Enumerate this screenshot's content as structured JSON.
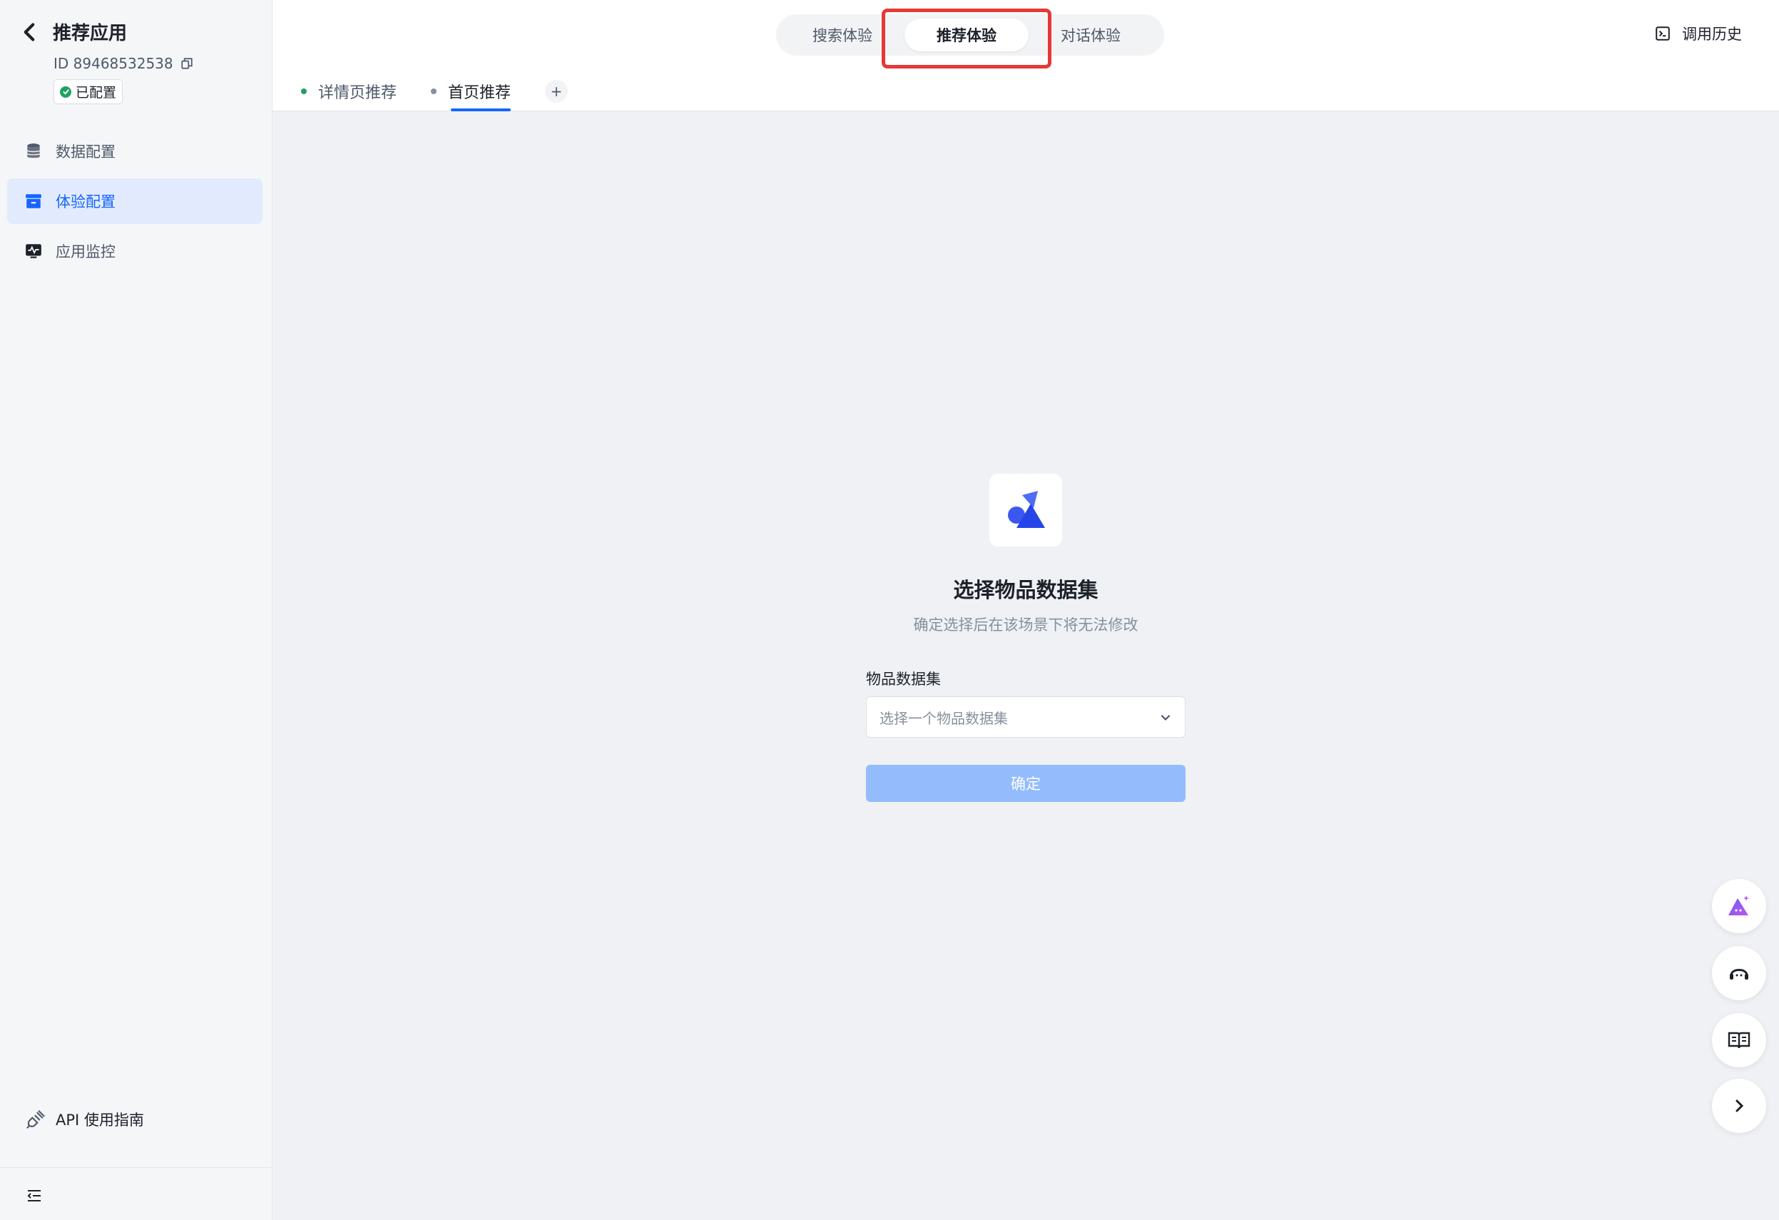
{
  "sidebar": {
    "app_title": "推荐应用",
    "app_id": "ID 89468532538",
    "status_badge": "已配置",
    "nav": [
      {
        "label": "数据配置",
        "icon": "database-icon",
        "active": false
      },
      {
        "label": "体验配置",
        "icon": "archive-box-icon",
        "active": true
      },
      {
        "label": "应用监控",
        "icon": "monitor-icon",
        "active": false
      }
    ],
    "api_guide": "API 使用指南"
  },
  "header": {
    "segments": [
      "搜索体验",
      "推荐体验",
      "对话体验"
    ],
    "active_segment": "推荐体验",
    "history": "调用历史",
    "subtabs": [
      {
        "label": "详情页推荐",
        "dot_color": "#20a162"
      },
      {
        "label": "首页推荐",
        "dot_color": "#86909c",
        "active": true
      }
    ],
    "add_tab": "+"
  },
  "main": {
    "title": "选择物品数据集",
    "subtitle": "确定选择后在该场景下将无法修改",
    "field_label": "物品数据集",
    "select_placeholder": "选择一个物品数据集",
    "confirm": "确定"
  },
  "colors": {
    "accent": "#1664ff",
    "highlight": "#e53935",
    "success": "#20a162"
  }
}
